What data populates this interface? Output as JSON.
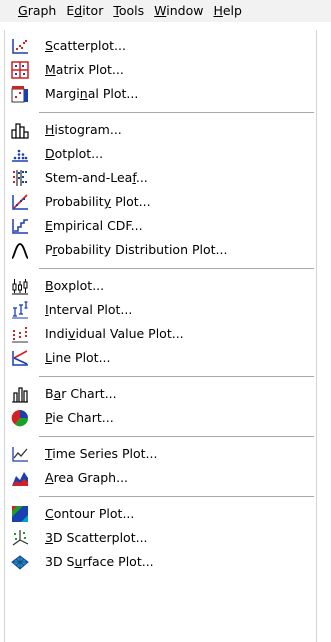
{
  "menubar": {
    "items": [
      {
        "pre": "",
        "ul": "G",
        "post": "raph"
      },
      {
        "pre": "E",
        "ul": "d",
        "post": "itor"
      },
      {
        "pre": "",
        "ul": "T",
        "post": "ools"
      },
      {
        "pre": "",
        "ul": "W",
        "post": "indow"
      },
      {
        "pre": "",
        "ul": "H",
        "post": "elp"
      }
    ]
  },
  "menu": {
    "items": [
      {
        "pre": "",
        "ul": "S",
        "post": "catterplot...",
        "icon": "scatterplot-icon"
      },
      {
        "pre": "",
        "ul": "M",
        "post": "atrix Plot...",
        "icon": "matrix-plot-icon"
      },
      {
        "pre": "Margi",
        "ul": "n",
        "post": "al Plot...",
        "icon": "marginal-plot-icon"
      },
      {
        "pre": "",
        "ul": "H",
        "post": "istogram...",
        "icon": "histogram-icon"
      },
      {
        "pre": "",
        "ul": "D",
        "post": "otplot...",
        "icon": "dotplot-icon"
      },
      {
        "pre": "Stem-and-Lea",
        "ul": "f",
        "post": "...",
        "icon": "stem-and-leaf-icon"
      },
      {
        "pre": "Probabilit",
        "ul": "y",
        "post": " Plot...",
        "icon": "probability-plot-icon"
      },
      {
        "pre": "",
        "ul": "E",
        "post": "mpirical CDF...",
        "icon": "empirical-cdf-icon"
      },
      {
        "pre": "P",
        "ul": "r",
        "post": "obability Distribution Plot...",
        "icon": "distribution-curve-icon"
      },
      {
        "pre": "",
        "ul": "B",
        "post": "oxplot...",
        "icon": "boxplot-icon"
      },
      {
        "pre": "",
        "ul": "I",
        "post": "nterval Plot...",
        "icon": "interval-plot-icon"
      },
      {
        "pre": "Indi",
        "ul": "v",
        "post": "idual Value Plot...",
        "icon": "individual-value-plot-icon"
      },
      {
        "pre": "",
        "ul": "L",
        "post": "ine Plot...",
        "icon": "line-plot-icon"
      },
      {
        "pre": "B",
        "ul": "a",
        "post": "r Chart...",
        "icon": "bar-chart-icon"
      },
      {
        "pre": "",
        "ul": "P",
        "post": "ie Chart...",
        "icon": "pie-chart-icon"
      },
      {
        "pre": "",
        "ul": "T",
        "post": "ime Series Plot...",
        "icon": "time-series-icon"
      },
      {
        "pre": "",
        "ul": "A",
        "post": "rea Graph...",
        "icon": "area-graph-icon"
      },
      {
        "pre": "",
        "ul": "C",
        "post": "ontour Plot...",
        "icon": "contour-plot-icon"
      },
      {
        "pre": "",
        "ul": "3",
        "post": "D Scatterplot...",
        "icon": "3d-scatterplot-icon"
      },
      {
        "pre": "3D S",
        "ul": "u",
        "post": "rface Plot...",
        "icon": "3d-surface-plot-icon"
      }
    ]
  },
  "colors": {
    "menubar_bg": "#f2f2f2",
    "menu_bg": "#ffffff",
    "separator": "#a8a8a8",
    "icon_red": "#d42020",
    "icon_blue": "#1a3fb0",
    "icon_green": "#1b9e2a"
  }
}
